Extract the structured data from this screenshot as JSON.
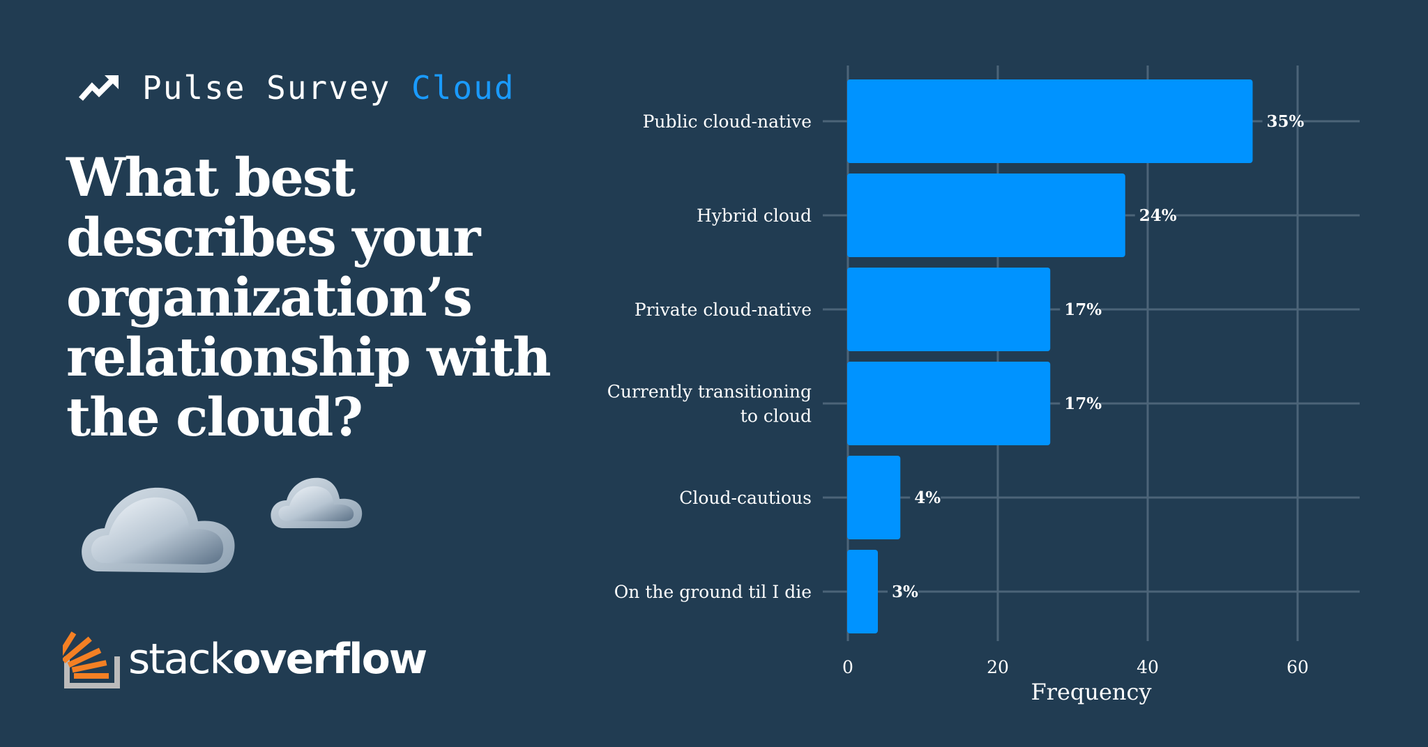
{
  "header": {
    "icon": "trending-up-icon",
    "brand_prefix": "Pulse Survey",
    "brand_accent": "Cloud"
  },
  "question": {
    "lines": [
      "What best",
      "describes your",
      "organization’s",
      "relationship with",
      "the cloud?"
    ]
  },
  "decorations": {
    "clouds": [
      "cloud-icon-large",
      "cloud-icon-small"
    ]
  },
  "logo": {
    "word_light": "stack",
    "word_bold": "overflow"
  },
  "colors": {
    "background": "#213c52",
    "bar": "#0093ff",
    "accent": "#1a9bff",
    "grid": "#4c6478",
    "logo_orange": "#f48024",
    "logo_gray": "#bcbbbb"
  },
  "chart_data": {
    "type": "bar",
    "orientation": "horizontal",
    "title": "What best describes your organization’s relationship with the cloud?",
    "categories": [
      [
        "Public cloud-native"
      ],
      [
        "Hybrid cloud"
      ],
      [
        "Private cloud-native"
      ],
      [
        "Currently transitioning",
        "to cloud"
      ],
      [
        "Cloud-cautious"
      ],
      [
        "On the ground til I die"
      ]
    ],
    "values": [
      54,
      37,
      27,
      27,
      7,
      4
    ],
    "data_labels": [
      "35%",
      "24%",
      "17%",
      "17%",
      "4%",
      "3%"
    ],
    "xlabel": "Frequency",
    "ylabel": "",
    "xlim": [
      0,
      66
    ],
    "xticks": [
      0,
      20,
      40,
      60
    ],
    "xtick_labels": [
      "0",
      "20",
      "40",
      "60"
    ],
    "grid": true,
    "legend": "none"
  }
}
